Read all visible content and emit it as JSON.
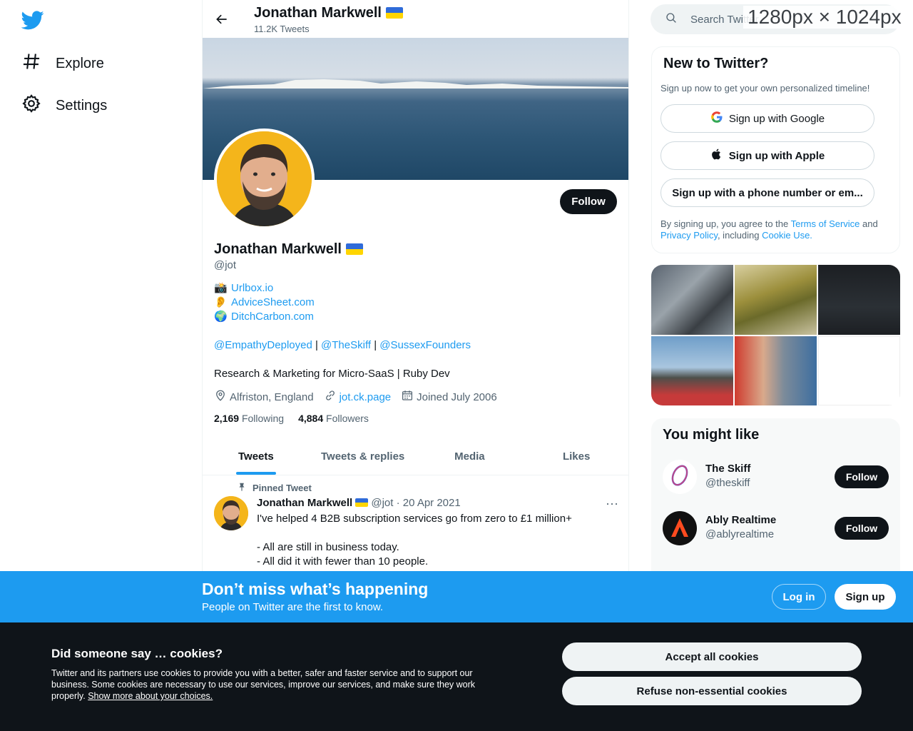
{
  "nav": {
    "explore_label": "Explore",
    "settings_label": "Settings"
  },
  "header": {
    "name": "Jonathan Markwell",
    "tweet_count": "11.2K Tweets"
  },
  "profile": {
    "name": "Jonathan Markwell",
    "handle": "@jot",
    "follow_label": "Follow",
    "links": [
      {
        "emoji": "📸",
        "text": "Urlbox.io"
      },
      {
        "emoji": "👂",
        "text": "AdviceSheet.com"
      },
      {
        "emoji": "🌍",
        "text": "DitchCarbon.com"
      }
    ],
    "mentions": [
      "@EmpathyDeployed",
      "@TheSkiff",
      "@SussexFounders"
    ],
    "mention_sep": " | ",
    "description": "Research & Marketing for Micro-SaaS | Ruby Dev",
    "location": "Alfriston, England",
    "website": "jot.ck.page",
    "joined": "Joined July 2006",
    "following_count": "2,169",
    "following_label": "Following",
    "followers_count": "4,884",
    "followers_label": "Followers"
  },
  "tabs": [
    {
      "label": "Tweets",
      "active": true
    },
    {
      "label": "Tweets & replies",
      "active": false
    },
    {
      "label": "Media",
      "active": false
    },
    {
      "label": "Likes",
      "active": false
    }
  ],
  "tweet": {
    "pinned_label": "Pinned Tweet",
    "author": "Jonathan Markwell",
    "handle": "@jot",
    "date": "20 Apr 2021",
    "more": "···",
    "line1": "I've helped 4 B2B subscription services go from zero to £1 million+",
    "line2": "- All are still in business today.",
    "line3": "- All did it with fewer than 10 people."
  },
  "search": {
    "placeholder": "Search Twitter"
  },
  "overlay_label": "1280px × 1024px",
  "signup": {
    "title": "New to Twitter?",
    "subtitle": "Sign up now to get your own personalized timeline!",
    "google_label": "Sign up with Google",
    "apple_label": "Sign up with Apple",
    "phone_label": "Sign up with a phone number or em...",
    "terms_prefix": "By signing up, you agree to the ",
    "terms_link": "Terms of Service",
    "terms_and": " and ",
    "privacy_link": "Privacy Policy",
    "terms_including": ", including ",
    "cookie_link": "Cookie Use."
  },
  "might_like": {
    "title": "You might like",
    "accounts": [
      {
        "name": "The Skiff",
        "handle": "@theskiff",
        "follow": "Follow"
      },
      {
        "name": "Ably Realtime",
        "handle": "@ablyrealtime",
        "follow": "Follow"
      }
    ]
  },
  "dont_miss": {
    "title": "Don’t miss what’s happening",
    "subtitle": "People on Twitter are the first to know.",
    "login_label": "Log in",
    "signup_label": "Sign up"
  },
  "cookies": {
    "title": "Did someone say … cookies?",
    "text": "Twitter and its partners use cookies to provide you with a better, safer and faster service and to support our business. Some cookies are necessary to use our services, improve our services, and make sure they work properly. ",
    "link": "Show more about your choices.",
    "accept_label": "Accept all cookies",
    "refuse_label": "Refuse non-essential cookies"
  },
  "colors": {
    "accent": "#1d9bf0",
    "text": "#0f1419",
    "muted": "#536471",
    "cookie_bg": "#0f1419"
  },
  "icons": [
    "twitter-bird-icon",
    "hashtag-icon",
    "gear-icon",
    "back-arrow-icon",
    "search-icon",
    "pin-icon",
    "location-icon",
    "link-icon",
    "calendar-icon",
    "google-icon",
    "apple-icon",
    "more-icon"
  ]
}
